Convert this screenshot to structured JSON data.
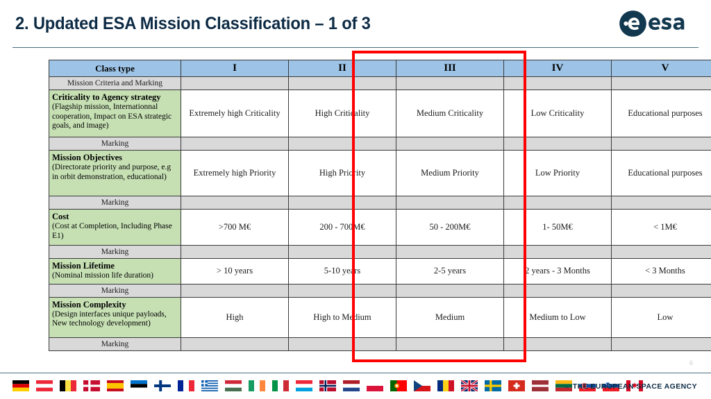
{
  "header": {
    "title": "2. Updated ESA Mission Classification – 1 of 3",
    "logo_text": "esa",
    "logo_icon": "esa-logo-icon"
  },
  "table": {
    "columns": [
      "Class type",
      "I",
      "II",
      "III",
      "IV",
      "V"
    ],
    "rows": [
      {
        "type": "marking",
        "label": "Mission Criteria and Marking",
        "values": [
          "",
          "",
          "",
          "",
          ""
        ]
      },
      {
        "type": "criterion",
        "title": "Criticality to Agency strategy",
        "sub": "(Flagship mission, Internationnal cooperation, Impact on ESA strategic goals, and image)",
        "values": [
          "Extremely high Criticality",
          "High Criticality",
          "Medium Criticality",
          "Low Criticality",
          "Educational purposes"
        ]
      },
      {
        "type": "marking",
        "label": "Marking",
        "values": [
          "",
          "",
          "",
          "",
          ""
        ]
      },
      {
        "type": "criterion",
        "title": "Mission Objectives",
        "sub": "(Directorate priority and purpose, e.g in orbit demonstration, educational)",
        "values": [
          "Extremely high Priority",
          "High Priority",
          "Medium Priority",
          "Low Priority",
          "Educational purposes"
        ]
      },
      {
        "type": "marking",
        "label": "Marking",
        "values": [
          "",
          "",
          "",
          "",
          ""
        ]
      },
      {
        "type": "criterion",
        "title": "Cost",
        "sub": "(Cost at Completion, Including Phase E1)",
        "values": [
          ">700 M€",
          "200 - 700M€",
          "50 - 200M€",
          "1- 50M€",
          "< 1M€"
        ]
      },
      {
        "type": "marking",
        "label": "Marking",
        "values": [
          "",
          "",
          "",
          "",
          ""
        ]
      },
      {
        "type": "criterion",
        "title": "Mission Lifetime",
        "sub": "(Nominal mission life duration)",
        "values": [
          "> 10 years",
          "5-10 years",
          "2-5 years",
          "2 years - 3 Months",
          "< 3 Months"
        ]
      },
      {
        "type": "marking",
        "label": "Marking",
        "values": [
          "",
          "",
          "",
          "",
          ""
        ]
      },
      {
        "type": "criterion",
        "title": "Mission Complexity",
        "sub": "(Design interfaces unique payloads, New technology development)",
        "values": [
          "High",
          "High to Medium",
          "Medium",
          "Medium to Low",
          "Low"
        ]
      },
      {
        "type": "marking",
        "label": "Marking",
        "values": [
          "",
          "",
          "",
          "",
          ""
        ]
      }
    ]
  },
  "highlight": {
    "name": "red-highlight-box",
    "color": "#FE0000",
    "covers_columns": [
      "III",
      "IV"
    ]
  },
  "footer": {
    "page_number": "6",
    "agency_text": "→ THE EUROPEAN SPACE AGENCY",
    "flags": [
      "Germany",
      "Austria",
      "Belgium",
      "Denmark",
      "Spain",
      "Estonia",
      "Finland",
      "France",
      "Greece",
      "Hungary",
      "Ireland",
      "Italy",
      "Luxembourg",
      "Norway",
      "Netherlands",
      "Poland",
      "Portugal",
      "Czech Republic",
      "Romania",
      "United Kingdom",
      "Sweden",
      "Switzerland",
      "Latvia",
      "Lithuania",
      "Slovakia",
      "Slovenia",
      "Canada"
    ]
  },
  "colors": {
    "header_blue": "#9DC3E6",
    "criterion_green": "#C6E0B4",
    "marking_grey": "#D9D9D9",
    "title_navy": "#0D2B45",
    "highlight_red": "#FE0000"
  }
}
